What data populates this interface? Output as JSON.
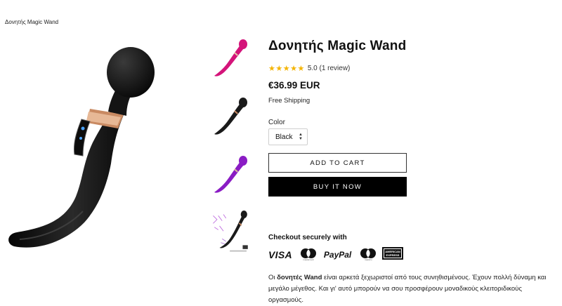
{
  "breadcrumb": "Δονητής Magic Wand",
  "product": {
    "title": "Δονητής Magic Wand",
    "stars": "★★★★★",
    "rating_text": "5.0 (1 review)",
    "price": "€36.99 EUR",
    "shipping": "Free Shipping",
    "color_label": "Color",
    "color_value": "Black",
    "select_arrow": "▲▼",
    "add_to_cart": "ADD TO CART",
    "buy_now": "BUY IT NOW"
  },
  "thumbnails": [
    {
      "name": "pink",
      "color": "#d4147a"
    },
    {
      "name": "black",
      "color": "#1a1a1a"
    },
    {
      "name": "purple",
      "color": "#8a1cc4"
    },
    {
      "name": "detail",
      "color": "#1a1a1a"
    }
  ],
  "checkout": {
    "label": "Checkout securely with",
    "visa": "VISA",
    "mastercard_text": "mastercard",
    "paypal": "PayPal",
    "maestro_text": "maestro",
    "amex_top": "AMERICAN",
    "amex_bottom": "EXPRESS"
  },
  "description": {
    "pre": "Οι ",
    "bold": "δονητές Wand",
    "post": " είναι αρκετά ξεχωριστοί από τους συνηθισμένους. Έχουν πολλή δύναμη και μεγάλο μέγεθος. Και γι' αυτό μπορούν να σου προσφέρουν μοναδικούς κλειτοριδικούς οργασμούς."
  },
  "colors": {
    "accent_black": "#000000",
    "star": "#f4b400",
    "copper": "#c98a62"
  }
}
